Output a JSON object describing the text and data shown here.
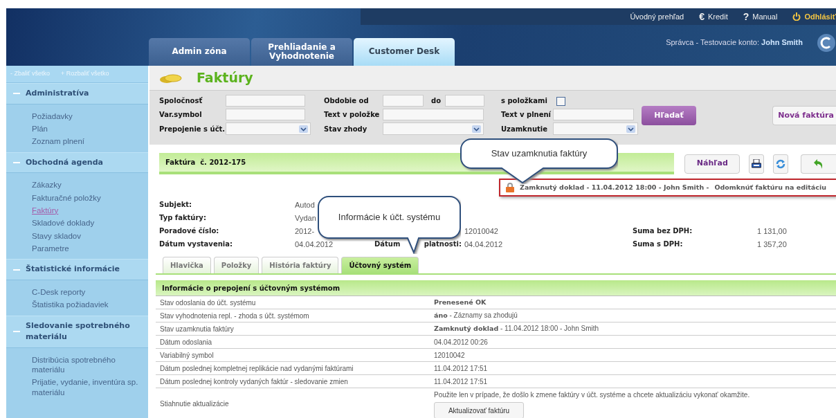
{
  "top_links": [
    {
      "label": "Úvodný prehľad",
      "kind": "link"
    },
    {
      "glyph": "€",
      "label": "Kredit",
      "kind": "link"
    },
    {
      "glyph": "?",
      "label": "Manual",
      "kind": "link"
    },
    {
      "label": "Odhlásiť",
      "kind": "logout"
    }
  ],
  "user": {
    "role": "Správca - Testovacie konto:",
    "name": "John Smith"
  },
  "main_tabs": [
    {
      "label": "Admin zóna",
      "selected": false
    },
    {
      "label": "Prehliadanie a Vyhodnotenie",
      "selected": false
    },
    {
      "label": "Customer Desk",
      "selected": true
    }
  ],
  "sidebar": {
    "collapse_glyph": "-",
    "collapse": "Zbaliť všetko",
    "expand_glyph": "+",
    "expand": "Rozbaliť všetko",
    "sections": [
      {
        "title": "Administratíva",
        "expanded": true,
        "items": [
          {
            "label": "Požiadavky",
            "selected": false
          },
          {
            "label": "Plán",
            "selected": false
          },
          {
            "label": "Zoznam plnení",
            "selected": false
          }
        ]
      },
      {
        "title": "Obchodná agenda",
        "expanded": true,
        "items": [
          {
            "label": "Zákazky",
            "selected": false
          },
          {
            "label": "Fakturačné položky",
            "selected": false
          },
          {
            "label": "Faktúry",
            "selected": true
          },
          {
            "label": "Skladové doklady",
            "selected": false
          },
          {
            "label": "Stavy skladov",
            "selected": false
          },
          {
            "label": "Parametre",
            "selected": false
          }
        ]
      },
      {
        "title": "Štatistické informácie",
        "expanded": true,
        "items": [
          {
            "label": "C-Desk reporty",
            "selected": false
          },
          {
            "label": "Štatistika požiadaviek",
            "selected": false
          }
        ]
      },
      {
        "title": "Sledovanie spotrebného materiálu",
        "expanded": true,
        "items": [
          {
            "label": "Distribúcia spotrebného materiálu",
            "selected": false
          },
          {
            "label": "Prijatie, vydanie, inventúra sp. materiálu",
            "selected": false
          }
        ]
      }
    ]
  },
  "page_title": "Faktúry",
  "filters": [
    [
      {
        "label": "Spoločnosť",
        "kind": "text"
      },
      {
        "label": "Obdobie od",
        "kind": "range",
        "label_to": "do"
      },
      {
        "label": "s položkami",
        "kind": "checkbox",
        "checked": false
      }
    ],
    [
      {
        "label": "Var.symbol",
        "kind": "text"
      },
      {
        "label": "Text v položke",
        "kind": "text"
      },
      {
        "label": "Text v plnení",
        "kind": "text"
      }
    ],
    [
      {
        "label": "Prepojenie s účt.",
        "kind": "select"
      },
      {
        "label": "Stav zhody",
        "kind": "select"
      },
      {
        "label": "Uzamknutie",
        "kind": "select"
      }
    ]
  ],
  "search_button": "Hľadať",
  "new_button": "Nová faktúra",
  "invoice": {
    "title": "Faktúra  č. 2012-175",
    "preview_button": "Náhľad"
  },
  "lock": {
    "status": "Zamknutý doklad - 11.04.2012 18:00 - John Smith -",
    "link": "Odomknúť faktúru na editáciu"
  },
  "details": [
    {
      "label": "Subjekt:",
      "value": "Autod"
    },
    {
      "label": "Typ faktúry:",
      "value": "Vydan"
    },
    {
      "label": "Poradové číslo:",
      "value": "2012-",
      "value2": "12010042",
      "label3": "Suma bez DPH:",
      "value3": "1 131,00"
    },
    {
      "label": "Dátum vystavenia:",
      "value": "04.04.2012",
      "label2": "Dátum",
      "label2_end": "platnosti:",
      "value2": "04.04.2012",
      "label3": "Suma s DPH:",
      "value3": "1 357,20"
    }
  ],
  "detail_tabs": [
    {
      "label": "Hlavička",
      "selected": false
    },
    {
      "label": "Položky",
      "selected": false
    },
    {
      "label": "História faktúry",
      "selected": false
    },
    {
      "label": "Účtovný systém",
      "selected": true
    }
  ],
  "section_title": "Informácie o prepojení s účtovným systémom",
  "rows": [
    {
      "label": "Stav odoslania do účt. systému",
      "value": "Prenesené OK",
      "bold": true
    },
    {
      "label": "Stav vyhodnotenia repl. - zhoda s účt. systémom",
      "value": "**áno** - Záznamy sa zhodujú",
      "bold": false
    },
    {
      "label": "Stav uzamknutia faktúry",
      "value": "**Zamknutý doklad** - 11.04.2012 18:00 - John Smith",
      "bold": false
    },
    {
      "label": "Dátum odoslania",
      "value": "04.04.2012 00:26",
      "bold": false
    },
    {
      "label": "Variabilný symbol",
      "value": "12010042",
      "bold": false
    },
    {
      "label": "Dátum poslednej kompletnej replikácie nad vydanými faktúrami",
      "value": "11.04.2012 17:51",
      "bold": false
    },
    {
      "label": "Dátum poslednej kontroly vydaných faktúr - sledovanie zmien",
      "value": "11.04.2012 17:51",
      "bold": false
    }
  ],
  "update_row": {
    "label": "Stiahnutie aktualizácie",
    "note": "Použite len v prípade, že došlo k zmene faktúry v účt. systéme a chcete aktualizáciu vykonať okamžite.",
    "button": "Aktualizovať faktúru"
  },
  "callouts": [
    {
      "text": "Stav uzamknutia faktúry",
      "kind": "lock"
    },
    {
      "text": "Informácie k účt. systému",
      "kind": "tabs"
    }
  ]
}
